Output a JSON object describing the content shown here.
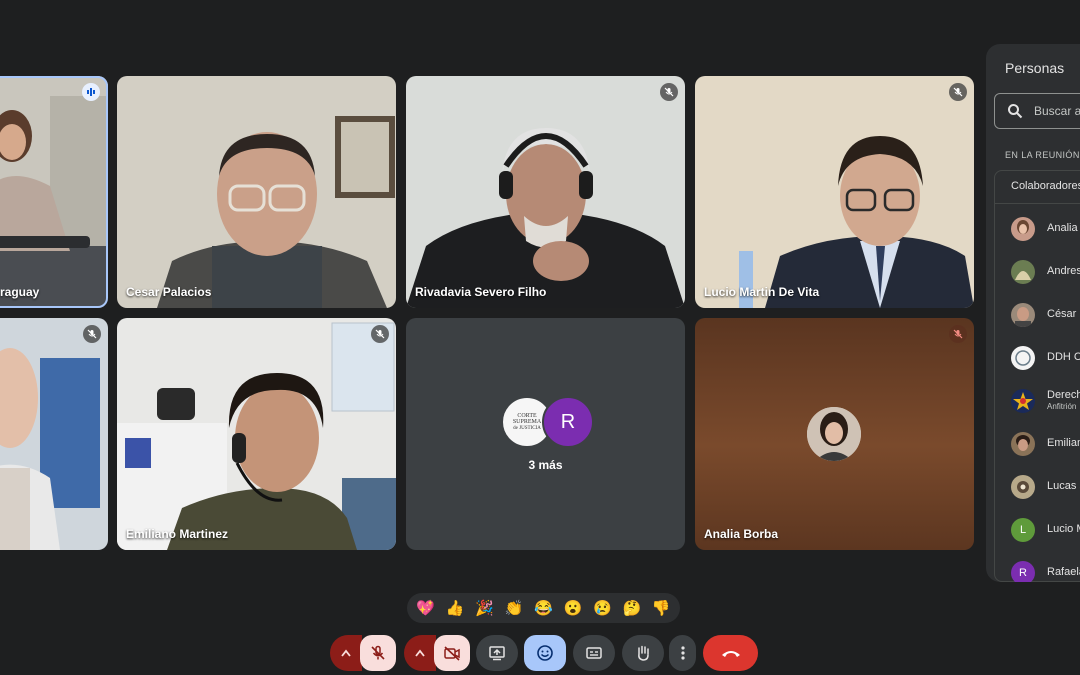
{
  "tiles": [
    {
      "name": "raguay"
    },
    {
      "name": "Cesar Palacios"
    },
    {
      "name": "Rivadavia Severo Filho"
    },
    {
      "name": "Lucio Martin De Vita"
    },
    {
      "name": ""
    },
    {
      "name": "Emiliano Martinez"
    },
    {
      "name": "Analia Borba"
    }
  ],
  "more": {
    "count_label": "3 más",
    "avatar_letter": "R",
    "logo_text": [
      "CORTE",
      "SUPREMA",
      "de JUSTICIA"
    ]
  },
  "panel": {
    "title": "Personas",
    "search_placeholder": "Buscar a",
    "section_label": "EN LA REUNIÓN",
    "group_label": "Colaboradores",
    "people": [
      {
        "name": "Analia B",
        "sub": "",
        "avatar": "photo",
        "color": "#c89b8a"
      },
      {
        "name": "Andres",
        "sub": "",
        "avatar": "photo",
        "color": "#6b7d52"
      },
      {
        "name": "César P",
        "sub": "",
        "avatar": "photo",
        "color": "#9a8a7a"
      },
      {
        "name": "DDH C",
        "sub": "",
        "avatar": "logo",
        "color": "#f4f4f4"
      },
      {
        "name": "Derech",
        "sub": "Anfitrión",
        "avatar": "logo-star",
        "color": "#1a2a5a"
      },
      {
        "name": "Emilian",
        "sub": "",
        "avatar": "photo",
        "color": "#8a7358"
      },
      {
        "name": "Lucas S",
        "sub": "",
        "avatar": "photo",
        "color": "#b7a98a"
      },
      {
        "name": "Lucio M",
        "sub": "",
        "avatar": "L",
        "color": "#5f9b3b"
      },
      {
        "name": "Rafaela",
        "sub": "",
        "avatar": "R",
        "color": "#7b2db0"
      }
    ]
  },
  "reactions": [
    "💖",
    "👍",
    "🎉",
    "👏",
    "😂",
    "😮",
    "😢",
    "🤔",
    "👎"
  ],
  "controls": {
    "mic": "muted",
    "camera": "off",
    "accent_red": "#ea4335",
    "dark_red": "#8c1d18",
    "pale_red": "#f9dedc",
    "active_blue": "#a8c7fa"
  }
}
